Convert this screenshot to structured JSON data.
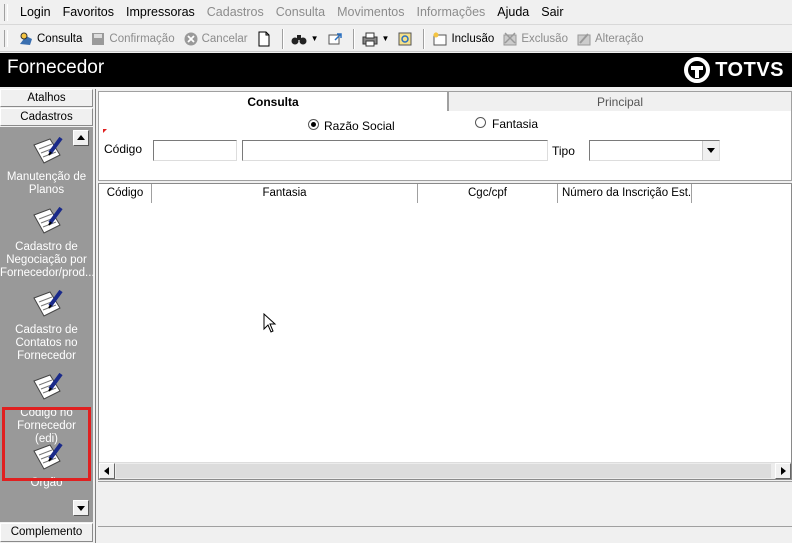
{
  "menu": {
    "items": [
      {
        "label": "Login",
        "enabled": true
      },
      {
        "label": "Favoritos",
        "enabled": true
      },
      {
        "label": "Impressoras",
        "enabled": true
      },
      {
        "label": "Cadastros",
        "enabled": false
      },
      {
        "label": "Consulta",
        "enabled": false
      },
      {
        "label": "Movimentos",
        "enabled": false
      },
      {
        "label": "Informações",
        "enabled": false
      },
      {
        "label": "Ajuda",
        "enabled": true
      },
      {
        "label": "Sair",
        "enabled": true
      }
    ]
  },
  "toolbar": {
    "consulta": "Consulta",
    "confirmacao": "Confirmação",
    "cancelar": "Cancelar",
    "inclusao": "Inclusão",
    "exclusao": "Exclusão",
    "alteracao": "Alteração"
  },
  "header": {
    "title": "Fornecedor",
    "logo_text": "TOTVS"
  },
  "sidebar": {
    "atalhos": "Atalhos",
    "cadastros": "Cadastros",
    "complemento": "Complemento",
    "items": [
      {
        "label": "Manutenção de Planos"
      },
      {
        "label": "Cadastro de Negociação por Fornecedor/prod..."
      },
      {
        "label": "Cadastro de Contatos no Fornecedor"
      },
      {
        "label": "Código no Fornecedor (edi)"
      },
      {
        "label": "Orgão"
      }
    ],
    "highlight_color": "#e02020"
  },
  "tabs": {
    "consulta": "Consulta",
    "principal": "Principal"
  },
  "form": {
    "radio_razao": "Razão Social",
    "radio_fantasia": "Fantasia",
    "selected_radio": "Razão Social",
    "codigo_label": "Código",
    "codigo_value": "",
    "nome_value": "",
    "tipo_label": "Tipo",
    "tipo_value": ""
  },
  "grid": {
    "columns": [
      "Código",
      "Fantasia",
      "Cgc/cpf",
      "Número da Inscrição Est..."
    ],
    "rows": []
  }
}
